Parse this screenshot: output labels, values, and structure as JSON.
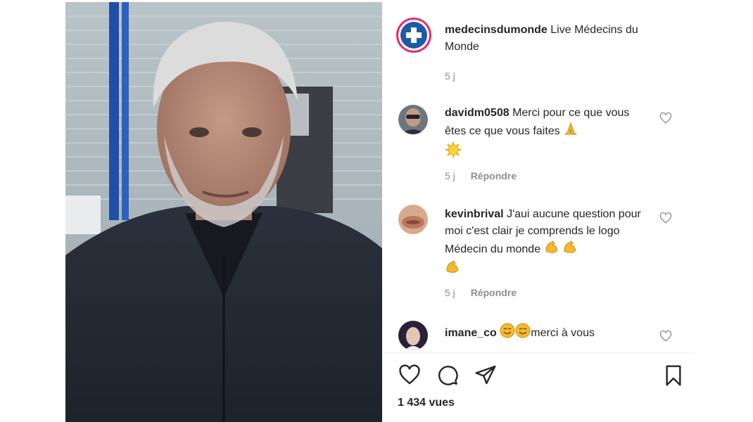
{
  "post": {
    "username": "medecinsdumonde",
    "caption": "Live Médecins du Monde",
    "time": "5 j"
  },
  "comments": [
    {
      "username": "davidm0508",
      "text": "Merci pour ce que vous êtes ce que vous faites",
      "time": "5 j",
      "reply": "Répondre"
    },
    {
      "username": "kevinbrival",
      "text": "J'aui aucune question pour moi c'est clair je comprends le logo Médecin du monde",
      "time": "5 j",
      "reply": "Répondre"
    },
    {
      "username": "imane_co",
      "text": "merci à vous"
    }
  ],
  "views": "1 434 vues",
  "icons": {
    "like": "heart-outline-icon",
    "comment": "comment-bubble-icon",
    "share": "paper-plane-icon",
    "save": "bookmark-icon"
  },
  "colors": {
    "brand_blue": "#1f5aa6",
    "brand_pink": "#e6296f",
    "text": "#262626",
    "muted": "#8e8e8e"
  }
}
